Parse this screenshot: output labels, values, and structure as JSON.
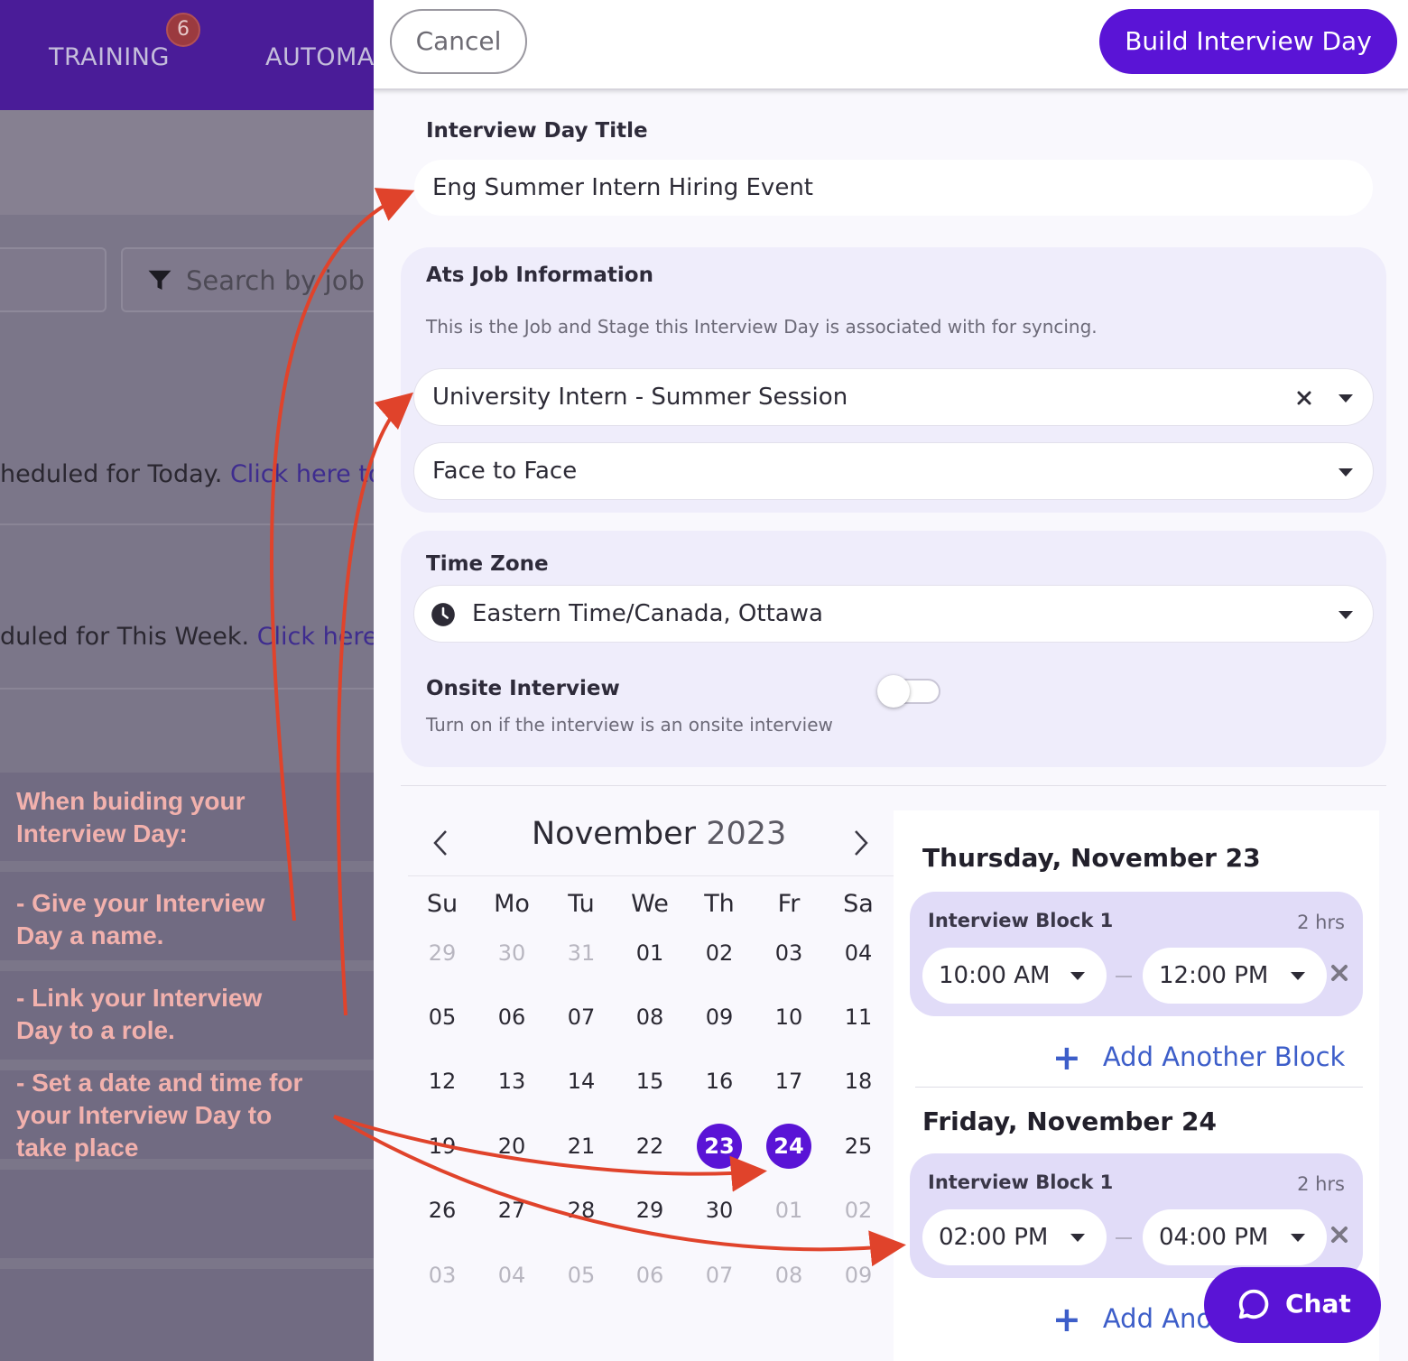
{
  "background_app": {
    "nav": {
      "training": "TRAINING",
      "training_badge": "6",
      "automations": "AUTOMA"
    },
    "search_placeholder": "Search by job",
    "today_text": "heduled for Today.",
    "today_link": "Click here to a",
    "week_text": "duled for This Week.",
    "week_link": "Click here to",
    "annotations": {
      "intro_line1": "When buiding your",
      "intro_line2": "Interview Day:",
      "step1_line1": "- Give your Interview",
      "step1_line2": "Day a name.",
      "step2_line1": "- Link your Interview",
      "step2_line2": "Day to a role.",
      "step3_line1": "- Set a date and time for",
      "step3_line2": "your Interview Day to",
      "step3_line3": "take place"
    }
  },
  "header": {
    "cancel": "Cancel",
    "build": "Build Interview Day"
  },
  "title_section": {
    "label": "Interview Day Title",
    "value": "Eng Summer Intern Hiring Event"
  },
  "ats": {
    "label": "Ats Job Information",
    "description": "This is the Job and Stage this Interview Day is associated with for syncing.",
    "job": "University Intern - Summer Session",
    "stage": "Face to Face"
  },
  "timezone": {
    "label": "Time Zone",
    "value": "Eastern Time/Canada, Ottawa",
    "onsite_label": "Onsite Interview",
    "onsite_desc": "Turn on if the interview is an onsite interview",
    "onsite_on": false
  },
  "calendar": {
    "month": "November",
    "year": "2023",
    "weekdays": [
      "Su",
      "Mo",
      "Tu",
      "We",
      "Th",
      "Fr",
      "Sa"
    ],
    "weeks": [
      [
        "29",
        "30",
        "31",
        "01",
        "02",
        "03",
        "04"
      ],
      [
        "05",
        "06",
        "07",
        "08",
        "09",
        "10",
        "11"
      ],
      [
        "12",
        "13",
        "14",
        "15",
        "16",
        "17",
        "18"
      ],
      [
        "19",
        "20",
        "21",
        "22",
        "23",
        "24",
        "25"
      ],
      [
        "26",
        "27",
        "28",
        "29",
        "30",
        "01",
        "02"
      ],
      [
        "03",
        "04",
        "05",
        "06",
        "07",
        "08",
        "09"
      ]
    ],
    "muted": [
      [
        0,
        0
      ],
      [
        0,
        1
      ],
      [
        0,
        2
      ],
      [
        4,
        5
      ],
      [
        4,
        6
      ],
      [
        5,
        0
      ],
      [
        5,
        1
      ],
      [
        5,
        2
      ],
      [
        5,
        3
      ],
      [
        5,
        4
      ],
      [
        5,
        5
      ],
      [
        5,
        6
      ]
    ],
    "selected": [
      [
        3,
        4
      ],
      [
        3,
        5
      ]
    ]
  },
  "schedule": [
    {
      "day": "Thursday, November 23",
      "block_name": "Interview Block 1",
      "duration": "2 hrs",
      "start": "10:00 AM",
      "end": "12:00 PM",
      "add_label": "Add Another Block"
    },
    {
      "day": "Friday, November 24",
      "block_name": "Interview Block 1",
      "duration": "2 hrs",
      "start": "02:00 PM",
      "end": "04:00 PM",
      "add_label": "Add Ano"
    }
  ],
  "chat": {
    "label": "Chat"
  },
  "colors": {
    "primary": "#5a14d6",
    "annotation_arrow": "#e0432b",
    "annotation_text": "#f2b1ad",
    "link": "#3d5ec9"
  }
}
